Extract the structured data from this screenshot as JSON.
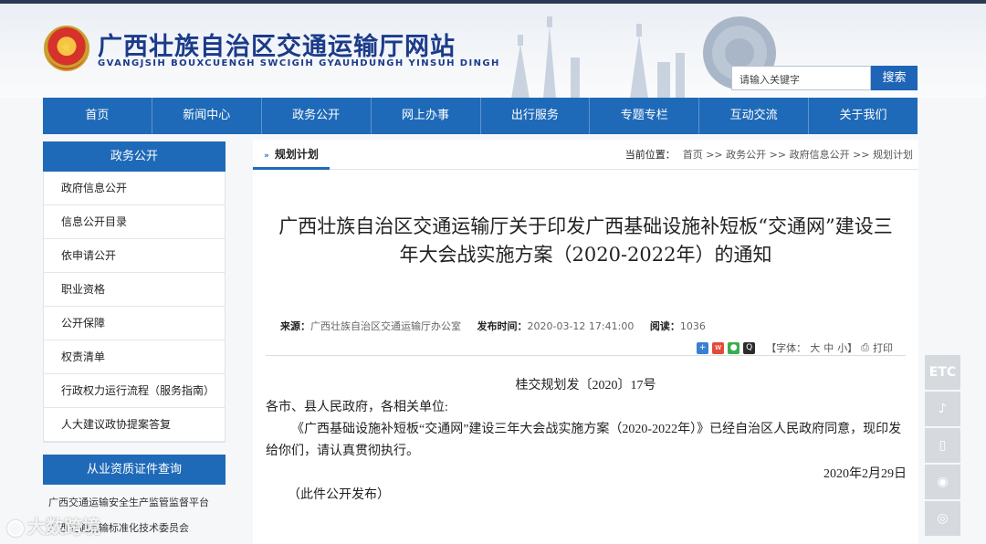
{
  "header": {
    "title": "广西壮族自治区交通运输厅网站",
    "subtitle": "GVANGJSIH BOUXCUENGH SWCIGIH GYAUHDUNGH YINSUH DINGH",
    "search_placeholder": "请输入关键字",
    "search_button": "搜索"
  },
  "nav": [
    "首页",
    "新闻中心",
    "政务公开",
    "网上办事",
    "出行服务",
    "专题专栏",
    "互动交流",
    "关于我们"
  ],
  "sidebar": {
    "title": "政务公开",
    "items": [
      "政府信息公开",
      "信息公开目录",
      "依申请公开",
      "职业资格",
      "公开保障",
      "权责清单",
      "行政权力运行流程（服务指南）",
      "人大建议政协提案答复"
    ],
    "section2_title": "从业资质证件查询",
    "section2_items": [
      "广西交通运输安全生产监管监督平台",
      "广西交通运输标准化技术委员会"
    ]
  },
  "breadcrumb": {
    "tab": "规划计划",
    "location_label": "当前位置：",
    "path": "首页 >> 政务公开 >> 政府信息公开 >> 规划计划"
  },
  "article": {
    "title": "广西壮族自治区交通运输厅关于印发广西基础设施补短板“交通网”建设三年大会战实施方案（2020-2022年）的通知",
    "source_label": "来源：",
    "source": "广西壮族自治区交通运输厅办公室",
    "time_label": "发布时间：",
    "time": "2020-03-12 17:41:00",
    "views_label": "阅读：",
    "views": "1036",
    "font_label": "【字体：",
    "font_large": "大",
    "font_mid": "中",
    "font_small": "小】",
    "print_label": "打印",
    "doc_number": "桂交规划发〔2020〕17号",
    "salutation": "各市、县人民政府，各相关单位:",
    "paragraph": "《广西基础设施补短板“交通网”建设三年大会战实施方案（2020-2022年）》已经自治区人民政府同意，现印发给你们，请认真贯彻执行。",
    "date": "2020年2月29日",
    "note": "（此件公开发布）"
  },
  "float_bar": [
    "ETC",
    "tiktok-icon",
    "phone-icon",
    "wechat-icon",
    "weibo-icon"
  ],
  "watermark": "大数跨境"
}
